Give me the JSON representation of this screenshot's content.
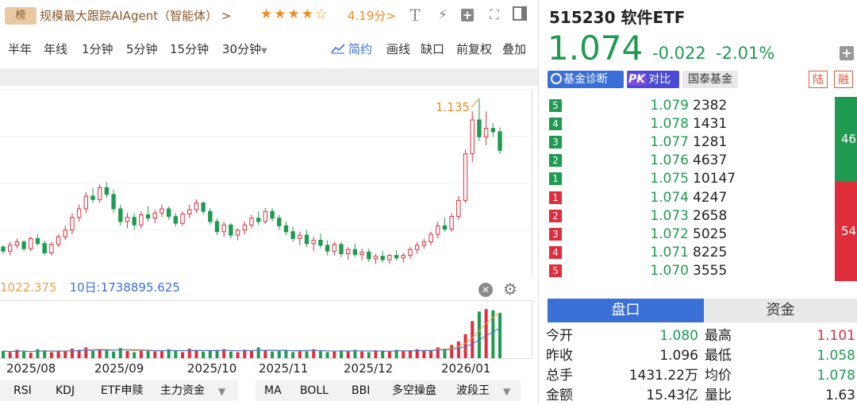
{
  "topbar": {
    "rank_badge": "榜",
    "rank_title": "规模最大跟踪AIAgent（智能体）",
    "rank_arrow": ">",
    "stars": "★★★★☆",
    "rating": "4.19分>",
    "tools": [
      "T",
      "⚡",
      "+",
      "⛶",
      "▣"
    ]
  },
  "periods": {
    "items": [
      "半年",
      "年线",
      "1分钟",
      "5分钟",
      "15分钟",
      "30分钟"
    ],
    "right_items": [
      "简约",
      "画线",
      "缺口",
      "前复权",
      "叠加"
    ],
    "active": "简约"
  },
  "kline": {
    "high_label": "1.135",
    "ma_left": "1022.375",
    "ma_10_label": "10日:1738895.625",
    "dates": [
      "2025/08",
      "2025/09",
      "2025/10",
      "2025/11",
      "2025/12",
      "2026/01"
    ],
    "candles": [
      [
        0.96,
        0.962,
        0.952,
        0.955
      ],
      [
        0.955,
        0.966,
        0.95,
        0.962
      ],
      [
        0.962,
        0.97,
        0.958,
        0.966
      ],
      [
        0.966,
        0.968,
        0.955,
        0.958
      ],
      [
        0.958,
        0.972,
        0.955,
        0.97
      ],
      [
        0.97,
        0.975,
        0.962,
        0.964
      ],
      [
        0.964,
        0.968,
        0.95,
        0.953
      ],
      [
        0.953,
        0.966,
        0.95,
        0.963
      ],
      [
        0.963,
        0.975,
        0.96,
        0.972
      ],
      [
        0.972,
        0.985,
        0.968,
        0.98
      ],
      [
        0.98,
        1.0,
        0.975,
        0.995
      ],
      [
        0.995,
        1.01,
        0.99,
        1.005
      ],
      [
        1.005,
        1.025,
        1.0,
        1.02
      ],
      [
        1.02,
        1.03,
        1.012,
        1.016
      ],
      [
        1.016,
        1.034,
        1.012,
        1.03
      ],
      [
        1.03,
        1.036,
        1.018,
        1.022
      ],
      [
        1.022,
        1.028,
        1.0,
        1.005
      ],
      [
        1.005,
        1.01,
        0.985,
        0.99
      ],
      [
        0.99,
        1.0,
        0.982,
        0.995
      ],
      [
        0.995,
        1.0,
        0.98,
        0.986
      ],
      [
        0.986,
        1.002,
        0.982,
        0.998
      ],
      [
        0.998,
        1.008,
        0.99,
        0.994
      ],
      [
        0.994,
        1.004,
        0.988,
        1.0
      ],
      [
        1.0,
        1.01,
        0.995,
        1.005
      ],
      [
        1.005,
        1.008,
        0.992,
        0.996
      ],
      [
        0.996,
        1.0,
        0.984,
        0.988
      ],
      [
        0.988,
        1.002,
        0.985,
        0.999
      ],
      [
        0.999,
        1.01,
        0.994,
        1.004
      ],
      [
        1.004,
        1.016,
        1.0,
        1.012
      ],
      [
        1.012,
        1.014,
        0.998,
        1.002
      ],
      [
        1.002,
        1.006,
        0.986,
        0.99
      ],
      [
        0.99,
        0.994,
        0.974,
        0.978
      ],
      [
        0.978,
        0.99,
        0.972,
        0.986
      ],
      [
        0.986,
        0.988,
        0.97,
        0.974
      ],
      [
        0.974,
        0.982,
        0.968,
        0.98
      ],
      [
        0.98,
        0.99,
        0.975,
        0.986
      ],
      [
        0.986,
        0.998,
        0.982,
        0.994
      ],
      [
        0.994,
        1.002,
        0.986,
        0.99
      ],
      [
        0.99,
        1.006,
        0.987,
        1.002
      ],
      [
        1.002,
        1.006,
        0.99,
        0.994
      ],
      [
        0.994,
        0.998,
        0.98,
        0.985
      ],
      [
        0.985,
        0.99,
        0.974,
        0.978
      ],
      [
        0.978,
        0.984,
        0.966,
        0.97
      ],
      [
        0.97,
        0.978,
        0.962,
        0.974
      ],
      [
        0.974,
        0.98,
        0.96,
        0.964
      ],
      [
        0.964,
        0.972,
        0.955,
        0.968
      ],
      [
        0.968,
        0.976,
        0.958,
        0.962
      ],
      [
        0.962,
        0.968,
        0.95,
        0.955
      ],
      [
        0.955,
        0.966,
        0.95,
        0.963
      ],
      [
        0.963,
        0.966,
        0.948,
        0.952
      ],
      [
        0.952,
        0.96,
        0.945,
        0.957
      ],
      [
        0.957,
        0.964,
        0.948,
        0.951
      ],
      [
        0.951,
        0.958,
        0.944,
        0.954
      ],
      [
        0.954,
        0.958,
        0.942,
        0.946
      ],
      [
        0.946,
        0.952,
        0.94,
        0.949
      ],
      [
        0.949,
        0.955,
        0.942,
        0.945
      ],
      [
        0.945,
        0.952,
        0.94,
        0.95
      ],
      [
        0.95,
        0.956,
        0.944,
        0.947
      ],
      [
        0.947,
        0.953,
        0.942,
        0.95
      ],
      [
        0.95,
        0.96,
        0.946,
        0.957
      ],
      [
        0.957,
        0.966,
        0.952,
        0.962
      ],
      [
        0.962,
        0.97,
        0.958,
        0.966
      ],
      [
        0.966,
        0.978,
        0.962,
        0.975
      ],
      [
        0.975,
        0.99,
        0.97,
        0.985
      ],
      [
        0.985,
        0.995,
        0.978,
        0.981
      ],
      [
        0.981,
        1.0,
        0.978,
        0.996
      ],
      [
        0.996,
        1.02,
        0.992,
        1.015
      ],
      [
        1.015,
        1.075,
        1.012,
        1.07
      ],
      [
        1.07,
        1.12,
        1.06,
        1.11
      ],
      [
        1.11,
        1.135,
        1.085,
        1.09
      ],
      [
        1.09,
        1.12,
        1.08,
        1.1
      ],
      [
        1.1,
        1.106,
        1.09,
        1.096
      ],
      [
        1.096,
        1.101,
        1.07,
        1.074
      ]
    ],
    "volumes": [
      12,
      10,
      14,
      11,
      9,
      15,
      13,
      10,
      12,
      11,
      16,
      14,
      18,
      12,
      15,
      13,
      11,
      17,
      12,
      10,
      14,
      12,
      11,
      13,
      15,
      12,
      10,
      16,
      14,
      11,
      13,
      12,
      15,
      11,
      10,
      14,
      12,
      18,
      13,
      11,
      12,
      14,
      10,
      13,
      11,
      15,
      12,
      10,
      11,
      13,
      12,
      14,
      11,
      10,
      13,
      12,
      11,
      14,
      12,
      13,
      15,
      12,
      14,
      18,
      16,
      22,
      28,
      40,
      62,
      78,
      82,
      80,
      76
    ]
  },
  "indicators_left": [
    "RSI",
    "KDJ",
    "ETF申赎",
    "主力资金"
  ],
  "indicators_right": [
    "MA",
    "BOLL",
    "BBI",
    "多空操盘",
    "波段王"
  ],
  "quote": {
    "code_name": "515230 软件ETF",
    "price": "1.074",
    "change": "-0.022",
    "change_pct": "-2.01%",
    "tags": [
      "基金诊断",
      "PK对比",
      "国泰基金"
    ],
    "tag_lu": "陆",
    "tag_rong": "融",
    "sell": [
      {
        "idx": "5",
        "price": "1.079",
        "vol": "2382"
      },
      {
        "idx": "4",
        "price": "1.078",
        "vol": "1431"
      },
      {
        "idx": "3",
        "price": "1.077",
        "vol": "1281"
      },
      {
        "idx": "2",
        "price": "1.076",
        "vol": "4637"
      },
      {
        "idx": "1",
        "price": "1.075",
        "vol": "10147"
      }
    ],
    "buy": [
      {
        "idx": "1",
        "price": "1.074",
        "vol": "4247"
      },
      {
        "idx": "2",
        "price": "1.073",
        "vol": "2658"
      },
      {
        "idx": "3",
        "price": "1.072",
        "vol": "5025"
      },
      {
        "idx": "4",
        "price": "1.071",
        "vol": "8225"
      },
      {
        "idx": "5",
        "price": "1.070",
        "vol": "3555"
      }
    ],
    "ratio_green": "46",
    "ratio_red": "54",
    "tabs": [
      "盘口",
      "资金"
    ],
    "stats": [
      {
        "l": "今开",
        "v": "1.080",
        "l2": "最高",
        "v2": "1.101"
      },
      {
        "l": "昨收",
        "v": "1.096",
        "l2": "最低",
        "v2": "1.058"
      },
      {
        "l": "总手",
        "v": "1431.22万",
        "l2": "均价",
        "v2": "1.078"
      },
      {
        "l": "金额",
        "v": "15.43亿",
        "l2": "量比",
        "v2": "1.63"
      }
    ]
  },
  "colors": {
    "up": "#e02d3c",
    "down": "#1f9b51",
    "accent": "#3a6fd8"
  }
}
